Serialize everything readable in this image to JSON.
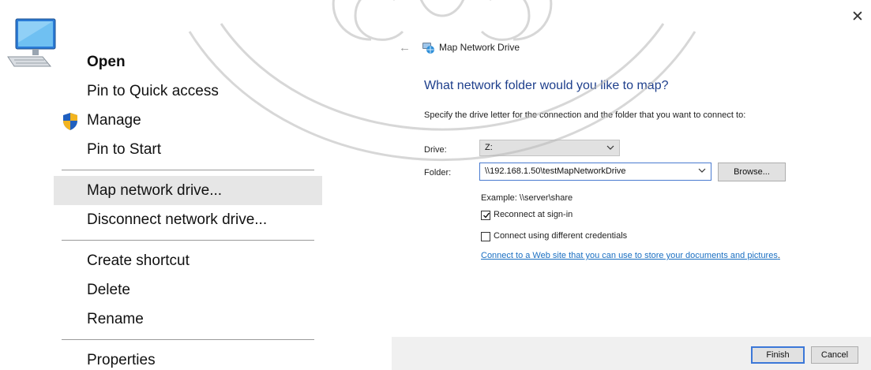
{
  "context_menu": {
    "items": [
      {
        "label": "Open"
      },
      {
        "label": "Pin to Quick access"
      },
      {
        "label": "Manage"
      },
      {
        "label": "Pin to Start"
      },
      {
        "label": "Map network drive..."
      },
      {
        "label": "Disconnect network drive..."
      },
      {
        "label": "Create shortcut"
      },
      {
        "label": "Delete"
      },
      {
        "label": "Rename"
      },
      {
        "label": "Properties"
      }
    ]
  },
  "dialog": {
    "title": "Map Network Drive",
    "close_glyph": "✕",
    "back_glyph": "←",
    "heading": "What network folder would you like to map?",
    "description": "Specify the drive letter for the connection and the folder that you want to connect to:",
    "drive": {
      "label": "Drive:",
      "value": "Z:"
    },
    "folder": {
      "label": "Folder:",
      "value": "\\\\192.168.1.50\\testMapNetworkDrive"
    },
    "browse_label": "Browse...",
    "example": "Example: \\\\server\\share",
    "reconnect": {
      "label": "Reconnect at sign-in",
      "checked": true
    },
    "different_credentials": {
      "label": "Connect using different credentials",
      "checked": false
    },
    "link_text": "Connect to a Web site that you can use to store your documents and pictures",
    "link_suffix": ".",
    "finish_label": "Finish",
    "cancel_label": "Cancel"
  },
  "colors": {
    "heading": "#1e3f8c",
    "link": "#1a6fc2",
    "menu_highlight": "#e6e6e6",
    "focus_border": "#3c78d8",
    "watermark": "#b8b8b8"
  },
  "icons": {
    "computer": "computer-icon",
    "shield": "uac-shield-icon",
    "network_drive": "network-drive-icon",
    "dropdown": "chevron-down-icon",
    "close": "close-icon",
    "back": "back-arrow-icon",
    "checkmark": "checkmark-icon"
  }
}
